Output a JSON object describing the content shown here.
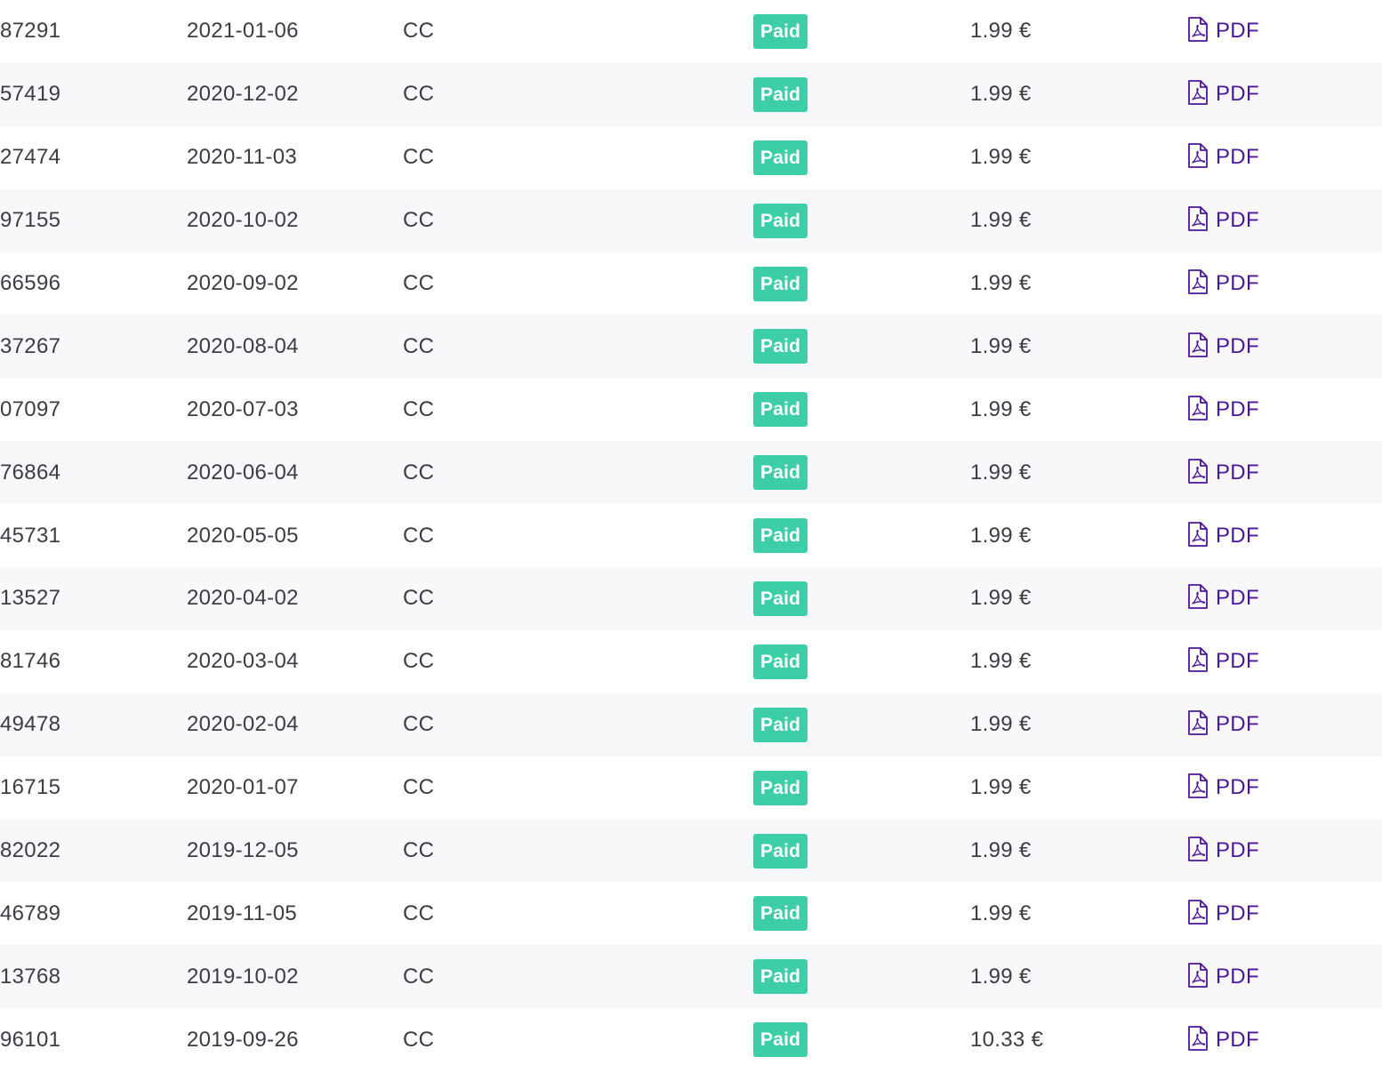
{
  "colors": {
    "badge_paid": "#3dcea7",
    "link": "#4b1699",
    "row_alt": "#f8f8fa"
  },
  "icons": {
    "document": "pdf-file-icon"
  },
  "invoices": [
    {
      "id": "87291",
      "date": "2021-01-06",
      "method": "CC",
      "status": "Paid",
      "amount": "1.99 €",
      "document": "PDF"
    },
    {
      "id": "57419",
      "date": "2020-12-02",
      "method": "CC",
      "status": "Paid",
      "amount": "1.99 €",
      "document": "PDF"
    },
    {
      "id": "27474",
      "date": "2020-11-03",
      "method": "CC",
      "status": "Paid",
      "amount": "1.99 €",
      "document": "PDF"
    },
    {
      "id": "97155",
      "date": "2020-10-02",
      "method": "CC",
      "status": "Paid",
      "amount": "1.99 €",
      "document": "PDF"
    },
    {
      "id": "66596",
      "date": "2020-09-02",
      "method": "CC",
      "status": "Paid",
      "amount": "1.99 €",
      "document": "PDF"
    },
    {
      "id": "37267",
      "date": "2020-08-04",
      "method": "CC",
      "status": "Paid",
      "amount": "1.99 €",
      "document": "PDF"
    },
    {
      "id": "07097",
      "date": "2020-07-03",
      "method": "CC",
      "status": "Paid",
      "amount": "1.99 €",
      "document": "PDF"
    },
    {
      "id": "76864",
      "date": "2020-06-04",
      "method": "CC",
      "status": "Paid",
      "amount": "1.99 €",
      "document": "PDF"
    },
    {
      "id": "45731",
      "date": "2020-05-05",
      "method": "CC",
      "status": "Paid",
      "amount": "1.99 €",
      "document": "PDF"
    },
    {
      "id": "13527",
      "date": "2020-04-02",
      "method": "CC",
      "status": "Paid",
      "amount": "1.99 €",
      "document": "PDF"
    },
    {
      "id": "81746",
      "date": "2020-03-04",
      "method": "CC",
      "status": "Paid",
      "amount": "1.99 €",
      "document": "PDF"
    },
    {
      "id": "49478",
      "date": "2020-02-04",
      "method": "CC",
      "status": "Paid",
      "amount": "1.99 €",
      "document": "PDF"
    },
    {
      "id": "16715",
      "date": "2020-01-07",
      "method": "CC",
      "status": "Paid",
      "amount": "1.99 €",
      "document": "PDF"
    },
    {
      "id": "82022",
      "date": "2019-12-05",
      "method": "CC",
      "status": "Paid",
      "amount": "1.99 €",
      "document": "PDF"
    },
    {
      "id": "46789",
      "date": "2019-11-05",
      "method": "CC",
      "status": "Paid",
      "amount": "1.99 €",
      "document": "PDF"
    },
    {
      "id": "13768",
      "date": "2019-10-02",
      "method": "CC",
      "status": "Paid",
      "amount": "1.99 €",
      "document": "PDF"
    },
    {
      "id": "96101",
      "date": "2019-09-26",
      "method": "CC",
      "status": "Paid",
      "amount": "10.33 €",
      "document": "PDF"
    }
  ]
}
